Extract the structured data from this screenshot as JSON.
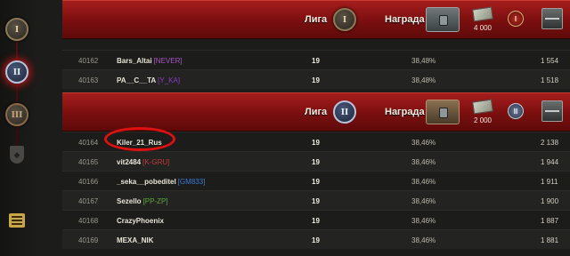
{
  "sidebar": {
    "items": [
      {
        "name": "league-1",
        "symbol": "I"
      },
      {
        "name": "league-2",
        "symbol": "II"
      },
      {
        "name": "league-3",
        "symbol": "III"
      }
    ]
  },
  "banners": [
    {
      "league_label": "Лига",
      "league_symbol": "I",
      "reward_label": "Награда",
      "credits": "4 000",
      "colors": {
        "emblem": "#c9a646"
      }
    },
    {
      "league_label": "Лига",
      "league_symbol": "II",
      "reward_label": "Награда",
      "credits": "2 000",
      "colors": {
        "emblem": "#b8c4dc"
      }
    }
  ],
  "rows_top": [
    {
      "rank": "40162",
      "name": "Bars_Altai",
      "clan": "[NEVER]",
      "clan_color": "#a855c8",
      "score": "19",
      "percent": "38,48%",
      "points": "1 554"
    },
    {
      "rank": "40163",
      "name": "PA__C__TA",
      "clan": "[Y_KA]",
      "clan_color": "#8a3cc8",
      "score": "19",
      "percent": "38,48%",
      "points": "1 518"
    }
  ],
  "rows_bottom": [
    {
      "rank": "40164",
      "name": "Kiler_21_Rus",
      "clan": "",
      "clan_color": "",
      "score": "19",
      "percent": "38,46%",
      "points": "2 138"
    },
    {
      "rank": "40165",
      "name": "vit2484",
      "clan": "[K-GRU]",
      "clan_color": "#c23a3a",
      "score": "19",
      "percent": "38,46%",
      "points": "1 944"
    },
    {
      "rank": "40166",
      "name": "_seka__pobeditel",
      "clan": "[GM833]",
      "clan_color": "#3a7ad8",
      "score": "19",
      "percent": "38,46%",
      "points": "1 911"
    },
    {
      "rank": "40167",
      "name": "Sezello",
      "clan": "[PP-ZP]",
      "clan_color": "#5aaa3a",
      "score": "19",
      "percent": "38,46%",
      "points": "1 900"
    },
    {
      "rank": "40168",
      "name": "CrazyPhoenix",
      "clan": "",
      "clan_color": "",
      "score": "19",
      "percent": "38,46%",
      "points": "1 887"
    },
    {
      "rank": "40169",
      "name": "MEXA_NIK",
      "clan": "",
      "clan_color": "",
      "score": "19",
      "percent": "38,46%",
      "points": "1 881"
    }
  ],
  "colors": {
    "accent": "#a51d1d",
    "highlight": "#e01010"
  }
}
